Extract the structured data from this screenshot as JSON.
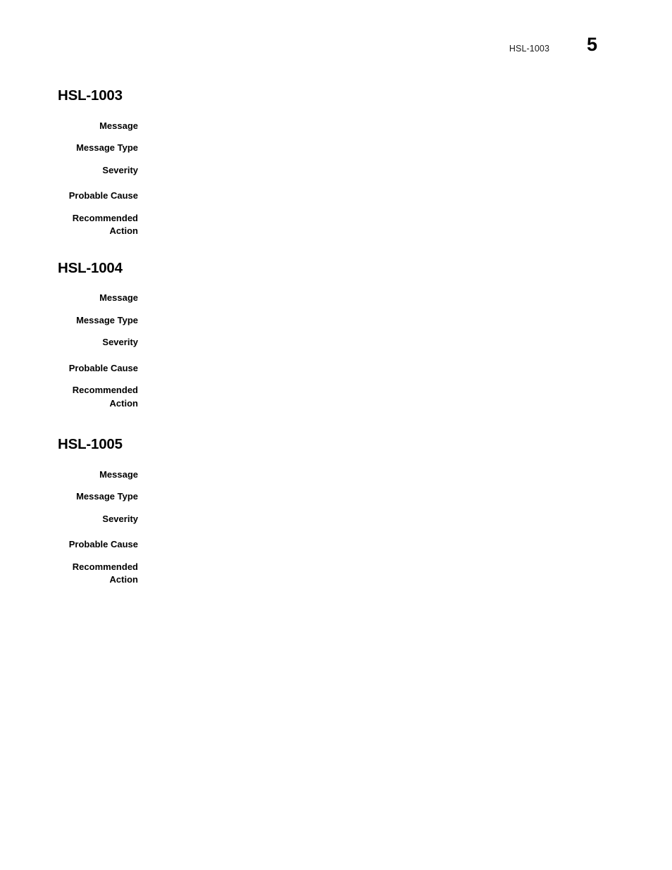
{
  "header": {
    "doc_id": "HSL-1003",
    "page_number": "5"
  },
  "sections": [
    {
      "heading": "HSL-1003",
      "fields": [
        {
          "label": "Message",
          "value": ""
        },
        {
          "label": "Message Type",
          "value": ""
        },
        {
          "label": "Severity",
          "value": ""
        },
        {
          "label": "Probable Cause",
          "value": ""
        },
        {
          "label": "Recommended\nAction",
          "value": ""
        }
      ]
    },
    {
      "heading": "HSL-1004",
      "fields": [
        {
          "label": "Message",
          "value": ""
        },
        {
          "label": "Message Type",
          "value": ""
        },
        {
          "label": "Severity",
          "value": ""
        },
        {
          "label": "Probable Cause",
          "value": ""
        },
        {
          "label": "Recommended\nAction",
          "value": ""
        }
      ]
    },
    {
      "heading": "HSL-1005",
      "fields": [
        {
          "label": "Message",
          "value": ""
        },
        {
          "label": "Message Type",
          "value": ""
        },
        {
          "label": "Severity",
          "value": ""
        },
        {
          "label": "Probable Cause",
          "value": ""
        },
        {
          "label": "Recommended\nAction",
          "value": ""
        }
      ]
    }
  ]
}
